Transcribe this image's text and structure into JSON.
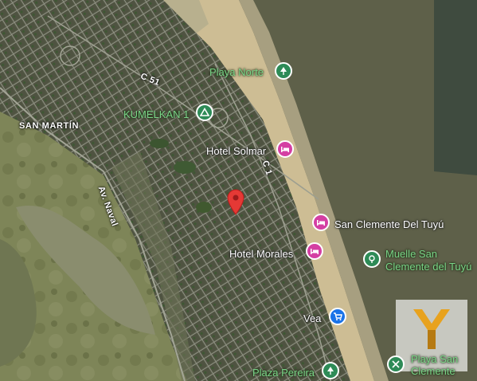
{
  "map": {
    "area": "SAN MARTÍN",
    "roads": [
      "C 51",
      "Av. Naval",
      "C 1"
    ],
    "pois": [
      {
        "name": "Playa Norte",
        "icon": "beach-icon",
        "category": "park",
        "color": "#2e8b57"
      },
      {
        "name": "KUMELKAN 1",
        "icon": "campground-icon",
        "category": "park",
        "color": "#2e8b57"
      },
      {
        "name": "Hotel Solmar",
        "icon": "hotel-icon",
        "category": "lodging",
        "color": "#d43fa3"
      },
      {
        "name": "San Clemente Del Tuyú",
        "icon": "hotel-icon",
        "category": "lodging",
        "color": "#d43fa3"
      },
      {
        "name": "Hotel Morales",
        "icon": "hotel-icon",
        "category": "lodging",
        "color": "#d43fa3"
      },
      {
        "name_line1": "Muelle San",
        "name_line2": "Clemente del Tuyú",
        "icon": "pier-icon",
        "category": "park",
        "color": "#2e8b57"
      },
      {
        "name": "Vea",
        "icon": "shopping-cart-icon",
        "category": "shopping",
        "color": "#1a73e8"
      },
      {
        "name": "Plaza Pereira",
        "icon": "tree-icon",
        "category": "park",
        "color": "#2e8b57"
      },
      {
        "name_line1": "Playa San",
        "name_line2": "Clemente",
        "icon": "beach-icon",
        "category": "park",
        "color": "#2e8b57"
      }
    ],
    "selected_marker": {
      "icon": "location-pin-icon",
      "color": "#e53935"
    }
  },
  "logo": {
    "glyph": "Y"
  }
}
